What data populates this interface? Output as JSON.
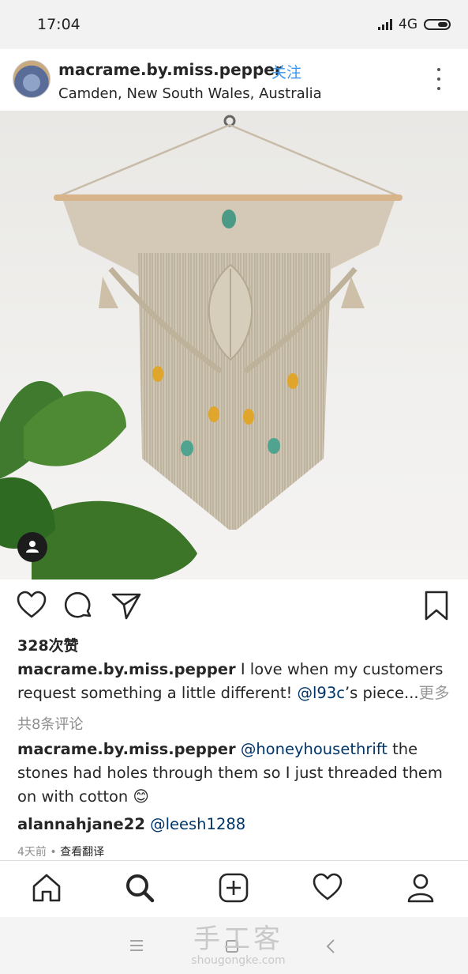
{
  "status": {
    "time": "17:04",
    "network": "4G"
  },
  "post": {
    "username": "macrame.by.miss.pepper",
    "separator": "•",
    "follow_label": "关注",
    "location": "Camden, New South Wales, Australia",
    "likes": "328次赞",
    "caption": {
      "user": "macrame.by.miss.pepper",
      "text1": " I love when my customers request something a little different! ",
      "mention": "@l93c",
      "text2": "’s piece",
      "ellipsis": "...",
      "more_label": "更多"
    },
    "view_all_comments": "共8条评论",
    "comments": [
      {
        "user": "macrame.by.miss.pepper",
        "mention": "@honeyhousethrift",
        "text": " the stones had holes through them so I just threaded them on with cotton ",
        "emoji": "😊"
      },
      {
        "user": "alannahjane22",
        "mention": "@leesh1288",
        "text": ""
      }
    ],
    "time_ago": "4天前",
    "dot": " • ",
    "translate_label": "查看翻译"
  },
  "icons": {
    "like": "heart-icon",
    "comment": "comment-icon",
    "share": "send-icon",
    "save": "bookmark-icon",
    "home": "home-icon",
    "search": "search-icon",
    "add": "add-icon",
    "activity": "heart-icon",
    "profile": "profile-icon"
  },
  "watermark": {
    "zh": "手工客",
    "en": "shougongke.com"
  },
  "colors": {
    "follow": "#3897f0",
    "mention": "#003569",
    "muted": "#8e8e8e"
  }
}
